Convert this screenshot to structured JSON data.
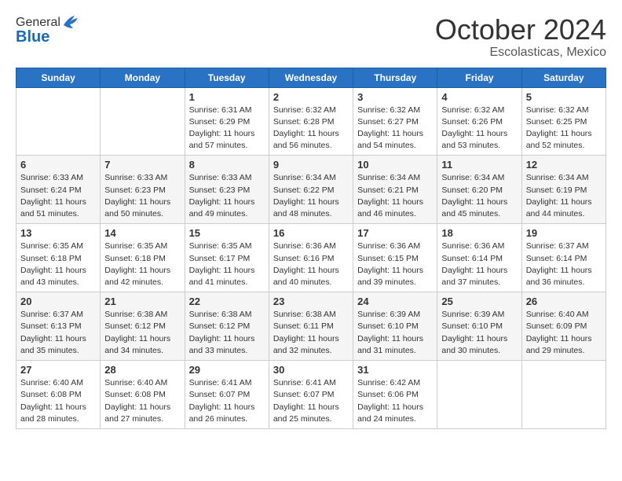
{
  "header": {
    "logo": {
      "general": "General",
      "blue": "Blue"
    },
    "title": "October 2024",
    "subtitle": "Escolasticas, Mexico"
  },
  "calendar": {
    "weekdays": [
      "Sunday",
      "Monday",
      "Tuesday",
      "Wednesday",
      "Thursday",
      "Friday",
      "Saturday"
    ],
    "weeks": [
      [
        {
          "day": "",
          "info": ""
        },
        {
          "day": "",
          "info": ""
        },
        {
          "day": "1",
          "info": "Sunrise: 6:31 AM\nSunset: 6:29 PM\nDaylight: 11 hours and 57 minutes."
        },
        {
          "day": "2",
          "info": "Sunrise: 6:32 AM\nSunset: 6:28 PM\nDaylight: 11 hours and 56 minutes."
        },
        {
          "day": "3",
          "info": "Sunrise: 6:32 AM\nSunset: 6:27 PM\nDaylight: 11 hours and 54 minutes."
        },
        {
          "day": "4",
          "info": "Sunrise: 6:32 AM\nSunset: 6:26 PM\nDaylight: 11 hours and 53 minutes."
        },
        {
          "day": "5",
          "info": "Sunrise: 6:32 AM\nSunset: 6:25 PM\nDaylight: 11 hours and 52 minutes."
        }
      ],
      [
        {
          "day": "6",
          "info": "Sunrise: 6:33 AM\nSunset: 6:24 PM\nDaylight: 11 hours and 51 minutes."
        },
        {
          "day": "7",
          "info": "Sunrise: 6:33 AM\nSunset: 6:23 PM\nDaylight: 11 hours and 50 minutes."
        },
        {
          "day": "8",
          "info": "Sunrise: 6:33 AM\nSunset: 6:23 PM\nDaylight: 11 hours and 49 minutes."
        },
        {
          "day": "9",
          "info": "Sunrise: 6:34 AM\nSunset: 6:22 PM\nDaylight: 11 hours and 48 minutes."
        },
        {
          "day": "10",
          "info": "Sunrise: 6:34 AM\nSunset: 6:21 PM\nDaylight: 11 hours and 46 minutes."
        },
        {
          "day": "11",
          "info": "Sunrise: 6:34 AM\nSunset: 6:20 PM\nDaylight: 11 hours and 45 minutes."
        },
        {
          "day": "12",
          "info": "Sunrise: 6:34 AM\nSunset: 6:19 PM\nDaylight: 11 hours and 44 minutes."
        }
      ],
      [
        {
          "day": "13",
          "info": "Sunrise: 6:35 AM\nSunset: 6:18 PM\nDaylight: 11 hours and 43 minutes."
        },
        {
          "day": "14",
          "info": "Sunrise: 6:35 AM\nSunset: 6:18 PM\nDaylight: 11 hours and 42 minutes."
        },
        {
          "day": "15",
          "info": "Sunrise: 6:35 AM\nSunset: 6:17 PM\nDaylight: 11 hours and 41 minutes."
        },
        {
          "day": "16",
          "info": "Sunrise: 6:36 AM\nSunset: 6:16 PM\nDaylight: 11 hours and 40 minutes."
        },
        {
          "day": "17",
          "info": "Sunrise: 6:36 AM\nSunset: 6:15 PM\nDaylight: 11 hours and 39 minutes."
        },
        {
          "day": "18",
          "info": "Sunrise: 6:36 AM\nSunset: 6:14 PM\nDaylight: 11 hours and 37 minutes."
        },
        {
          "day": "19",
          "info": "Sunrise: 6:37 AM\nSunset: 6:14 PM\nDaylight: 11 hours and 36 minutes."
        }
      ],
      [
        {
          "day": "20",
          "info": "Sunrise: 6:37 AM\nSunset: 6:13 PM\nDaylight: 11 hours and 35 minutes."
        },
        {
          "day": "21",
          "info": "Sunrise: 6:38 AM\nSunset: 6:12 PM\nDaylight: 11 hours and 34 minutes."
        },
        {
          "day": "22",
          "info": "Sunrise: 6:38 AM\nSunset: 6:12 PM\nDaylight: 11 hours and 33 minutes."
        },
        {
          "day": "23",
          "info": "Sunrise: 6:38 AM\nSunset: 6:11 PM\nDaylight: 11 hours and 32 minutes."
        },
        {
          "day": "24",
          "info": "Sunrise: 6:39 AM\nSunset: 6:10 PM\nDaylight: 11 hours and 31 minutes."
        },
        {
          "day": "25",
          "info": "Sunrise: 6:39 AM\nSunset: 6:10 PM\nDaylight: 11 hours and 30 minutes."
        },
        {
          "day": "26",
          "info": "Sunrise: 6:40 AM\nSunset: 6:09 PM\nDaylight: 11 hours and 29 minutes."
        }
      ],
      [
        {
          "day": "27",
          "info": "Sunrise: 6:40 AM\nSunset: 6:08 PM\nDaylight: 11 hours and 28 minutes."
        },
        {
          "day": "28",
          "info": "Sunrise: 6:40 AM\nSunset: 6:08 PM\nDaylight: 11 hours and 27 minutes."
        },
        {
          "day": "29",
          "info": "Sunrise: 6:41 AM\nSunset: 6:07 PM\nDaylight: 11 hours and 26 minutes."
        },
        {
          "day": "30",
          "info": "Sunrise: 6:41 AM\nSunset: 6:07 PM\nDaylight: 11 hours and 25 minutes."
        },
        {
          "day": "31",
          "info": "Sunrise: 6:42 AM\nSunset: 6:06 PM\nDaylight: 11 hours and 24 minutes."
        },
        {
          "day": "",
          "info": ""
        },
        {
          "day": "",
          "info": ""
        }
      ]
    ]
  }
}
